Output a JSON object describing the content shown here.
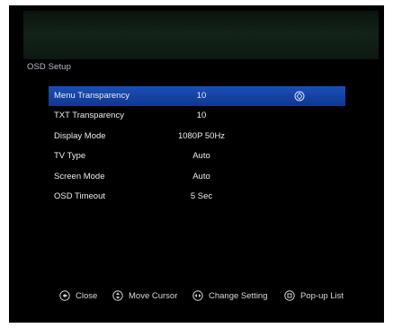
{
  "page": {
    "title": "OSD Setup"
  },
  "menu": {
    "items": [
      {
        "label": "Menu Transparency",
        "value": "10"
      },
      {
        "label": "TXT Transparency",
        "value": "10"
      },
      {
        "label": "Display Mode",
        "value": "1080P 50Hz"
      },
      {
        "label": "TV Type",
        "value": "Auto"
      },
      {
        "label": "Screen Mode",
        "value": "Auto"
      },
      {
        "label": "OSD Timeout",
        "value": "5 Sec"
      }
    ],
    "selected_index": 0
  },
  "footer": {
    "hints": [
      {
        "icon": "exit-key-icon",
        "label": "Close"
      },
      {
        "icon": "up-down-key-icon",
        "label": "Move Cursor"
      },
      {
        "icon": "left-right-key-icon",
        "label": "Change Setting"
      },
      {
        "icon": "ok-key-icon",
        "label": "Pop-up List"
      }
    ]
  },
  "colors": {
    "background": "#000000",
    "selection": "#1a4fb8",
    "text": "#ececec",
    "title": "#b9bec7",
    "header_band": "#13231a"
  }
}
